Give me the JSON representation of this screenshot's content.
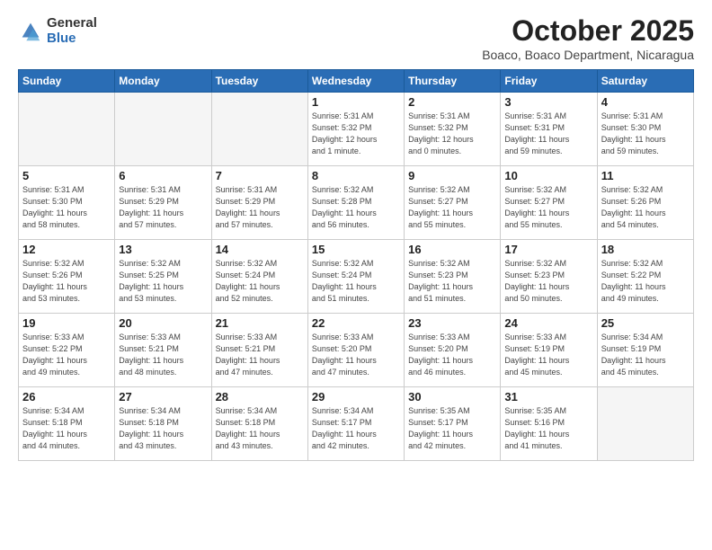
{
  "header": {
    "logo_general": "General",
    "logo_blue": "Blue",
    "month_title": "October 2025",
    "subtitle": "Boaco, Boaco Department, Nicaragua"
  },
  "weekdays": [
    "Sunday",
    "Monday",
    "Tuesday",
    "Wednesday",
    "Thursday",
    "Friday",
    "Saturday"
  ],
  "weeks": [
    [
      {
        "day": "",
        "info": ""
      },
      {
        "day": "",
        "info": ""
      },
      {
        "day": "",
        "info": ""
      },
      {
        "day": "1",
        "info": "Sunrise: 5:31 AM\nSunset: 5:32 PM\nDaylight: 12 hours\nand 1 minute."
      },
      {
        "day": "2",
        "info": "Sunrise: 5:31 AM\nSunset: 5:32 PM\nDaylight: 12 hours\nand 0 minutes."
      },
      {
        "day": "3",
        "info": "Sunrise: 5:31 AM\nSunset: 5:31 PM\nDaylight: 11 hours\nand 59 minutes."
      },
      {
        "day": "4",
        "info": "Sunrise: 5:31 AM\nSunset: 5:30 PM\nDaylight: 11 hours\nand 59 minutes."
      }
    ],
    [
      {
        "day": "5",
        "info": "Sunrise: 5:31 AM\nSunset: 5:30 PM\nDaylight: 11 hours\nand 58 minutes."
      },
      {
        "day": "6",
        "info": "Sunrise: 5:31 AM\nSunset: 5:29 PM\nDaylight: 11 hours\nand 57 minutes."
      },
      {
        "day": "7",
        "info": "Sunrise: 5:31 AM\nSunset: 5:29 PM\nDaylight: 11 hours\nand 57 minutes."
      },
      {
        "day": "8",
        "info": "Sunrise: 5:32 AM\nSunset: 5:28 PM\nDaylight: 11 hours\nand 56 minutes."
      },
      {
        "day": "9",
        "info": "Sunrise: 5:32 AM\nSunset: 5:27 PM\nDaylight: 11 hours\nand 55 minutes."
      },
      {
        "day": "10",
        "info": "Sunrise: 5:32 AM\nSunset: 5:27 PM\nDaylight: 11 hours\nand 55 minutes."
      },
      {
        "day": "11",
        "info": "Sunrise: 5:32 AM\nSunset: 5:26 PM\nDaylight: 11 hours\nand 54 minutes."
      }
    ],
    [
      {
        "day": "12",
        "info": "Sunrise: 5:32 AM\nSunset: 5:26 PM\nDaylight: 11 hours\nand 53 minutes."
      },
      {
        "day": "13",
        "info": "Sunrise: 5:32 AM\nSunset: 5:25 PM\nDaylight: 11 hours\nand 53 minutes."
      },
      {
        "day": "14",
        "info": "Sunrise: 5:32 AM\nSunset: 5:24 PM\nDaylight: 11 hours\nand 52 minutes."
      },
      {
        "day": "15",
        "info": "Sunrise: 5:32 AM\nSunset: 5:24 PM\nDaylight: 11 hours\nand 51 minutes."
      },
      {
        "day": "16",
        "info": "Sunrise: 5:32 AM\nSunset: 5:23 PM\nDaylight: 11 hours\nand 51 minutes."
      },
      {
        "day": "17",
        "info": "Sunrise: 5:32 AM\nSunset: 5:23 PM\nDaylight: 11 hours\nand 50 minutes."
      },
      {
        "day": "18",
        "info": "Sunrise: 5:32 AM\nSunset: 5:22 PM\nDaylight: 11 hours\nand 49 minutes."
      }
    ],
    [
      {
        "day": "19",
        "info": "Sunrise: 5:33 AM\nSunset: 5:22 PM\nDaylight: 11 hours\nand 49 minutes."
      },
      {
        "day": "20",
        "info": "Sunrise: 5:33 AM\nSunset: 5:21 PM\nDaylight: 11 hours\nand 48 minutes."
      },
      {
        "day": "21",
        "info": "Sunrise: 5:33 AM\nSunset: 5:21 PM\nDaylight: 11 hours\nand 47 minutes."
      },
      {
        "day": "22",
        "info": "Sunrise: 5:33 AM\nSunset: 5:20 PM\nDaylight: 11 hours\nand 47 minutes."
      },
      {
        "day": "23",
        "info": "Sunrise: 5:33 AM\nSunset: 5:20 PM\nDaylight: 11 hours\nand 46 minutes."
      },
      {
        "day": "24",
        "info": "Sunrise: 5:33 AM\nSunset: 5:19 PM\nDaylight: 11 hours\nand 45 minutes."
      },
      {
        "day": "25",
        "info": "Sunrise: 5:34 AM\nSunset: 5:19 PM\nDaylight: 11 hours\nand 45 minutes."
      }
    ],
    [
      {
        "day": "26",
        "info": "Sunrise: 5:34 AM\nSunset: 5:18 PM\nDaylight: 11 hours\nand 44 minutes."
      },
      {
        "day": "27",
        "info": "Sunrise: 5:34 AM\nSunset: 5:18 PM\nDaylight: 11 hours\nand 43 minutes."
      },
      {
        "day": "28",
        "info": "Sunrise: 5:34 AM\nSunset: 5:18 PM\nDaylight: 11 hours\nand 43 minutes."
      },
      {
        "day": "29",
        "info": "Sunrise: 5:34 AM\nSunset: 5:17 PM\nDaylight: 11 hours\nand 42 minutes."
      },
      {
        "day": "30",
        "info": "Sunrise: 5:35 AM\nSunset: 5:17 PM\nDaylight: 11 hours\nand 42 minutes."
      },
      {
        "day": "31",
        "info": "Sunrise: 5:35 AM\nSunset: 5:16 PM\nDaylight: 11 hours\nand 41 minutes."
      },
      {
        "day": "",
        "info": ""
      }
    ]
  ]
}
